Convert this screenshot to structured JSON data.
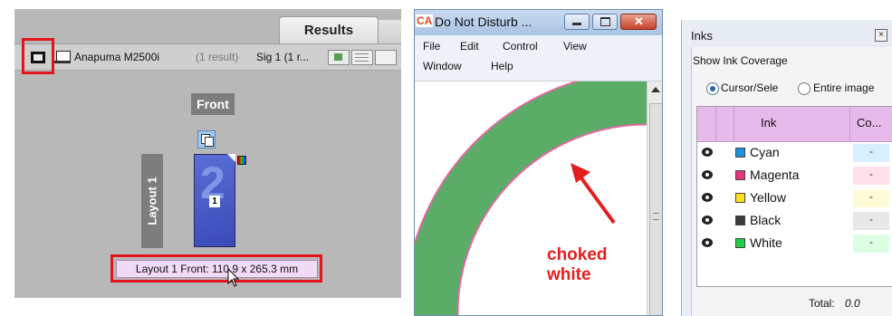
{
  "panel1": {
    "tab_label": "Results",
    "device_name": "Anapuma M2500i",
    "result_count": "(1 result)",
    "sig_label": "Sig 1 (1 r...",
    "page_label": "Front",
    "layout_label": "Layout 1",
    "page_number": "1",
    "tooltip": "Layout 1 Front: 110.9 x 265.3 mm",
    "highlight_color": "#e3141b"
  },
  "panel2": {
    "window_title": "Do Not Disturb ...",
    "app_badge": "CA",
    "menu": [
      "File",
      "Edit",
      "Control",
      "View",
      "Window",
      "Help"
    ],
    "annotation": [
      "choked",
      "white"
    ],
    "shape_color": "#5aac67",
    "outline_color": "#e06aa3",
    "annotation_color": "#e41e1e"
  },
  "panel3": {
    "title": "Inks",
    "section_label": "Show Ink Coverage",
    "radio_cursor": "Cursor/Sele",
    "radio_entire": "Entire image",
    "col_ink": "Ink",
    "col_coverage": "Co...",
    "inks": [
      {
        "name": "Cyan",
        "color": "#1e90e0",
        "cov_bg": "#d6f0ff",
        "coverage": "-"
      },
      {
        "name": "Magenta",
        "color": "#e6337a",
        "cov_bg": "#ffe0ea",
        "coverage": "-"
      },
      {
        "name": "Yellow",
        "color": "#ffe21a",
        "cov_bg": "#fffbd6",
        "coverage": "-"
      },
      {
        "name": "Black",
        "color": "#3a3a3a",
        "cov_bg": "#e8e8e8",
        "coverage": "-"
      },
      {
        "name": "White",
        "color": "#1ed246",
        "cov_bg": "#dcffe4",
        "coverage": "-"
      }
    ],
    "total_label": "Total:",
    "total_value": "0.0"
  }
}
